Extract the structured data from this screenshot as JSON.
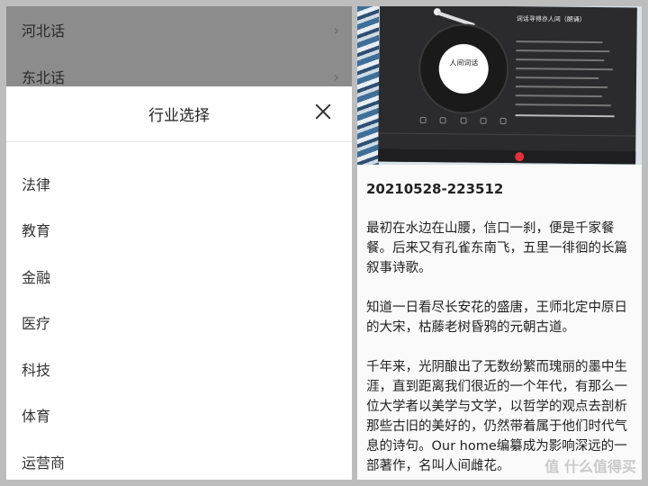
{
  "left": {
    "background_list": [
      {
        "label": "河北话"
      },
      {
        "label": "东北话"
      }
    ],
    "chevron": "›",
    "sheet": {
      "title": "行业选择",
      "close_icon": "close-icon",
      "items": [
        {
          "label": "法律"
        },
        {
          "label": "教育"
        },
        {
          "label": "金融"
        },
        {
          "label": "医疗"
        },
        {
          "label": "科技"
        },
        {
          "label": "体育"
        },
        {
          "label": "运营商"
        }
      ]
    }
  },
  "right": {
    "note_title": "20210528-223512",
    "paragraphs": [
      "最初在水边在山腰，信口一刹，便是千家餐餐。后来又有孔雀东南飞，五里一徘徊的长篇叙事诗歌。",
      "知道一日看尽长安花的盛唐，王师北定中原日的大宋，枯藤老树昏鸦的元朝古道。",
      "千年来，光阴酿出了无数纷繁而瑰丽的墨中生涯，直到距离我们很近的一个年代，有那么一位大学者以美学与文学，以哲学的观点去剖析那些古旧的美好的，仍然带着属于他们时代气息的诗句。Our home编纂成为影响深远的一部著作，名叫人间雌花。"
    ],
    "player": {
      "song_title": "词话寻得亦人间（朗诵）"
    },
    "watermark": "值 什么值得买"
  },
  "colors": {
    "overlay": "#8c8c8c",
    "accent": "#e0323a"
  }
}
